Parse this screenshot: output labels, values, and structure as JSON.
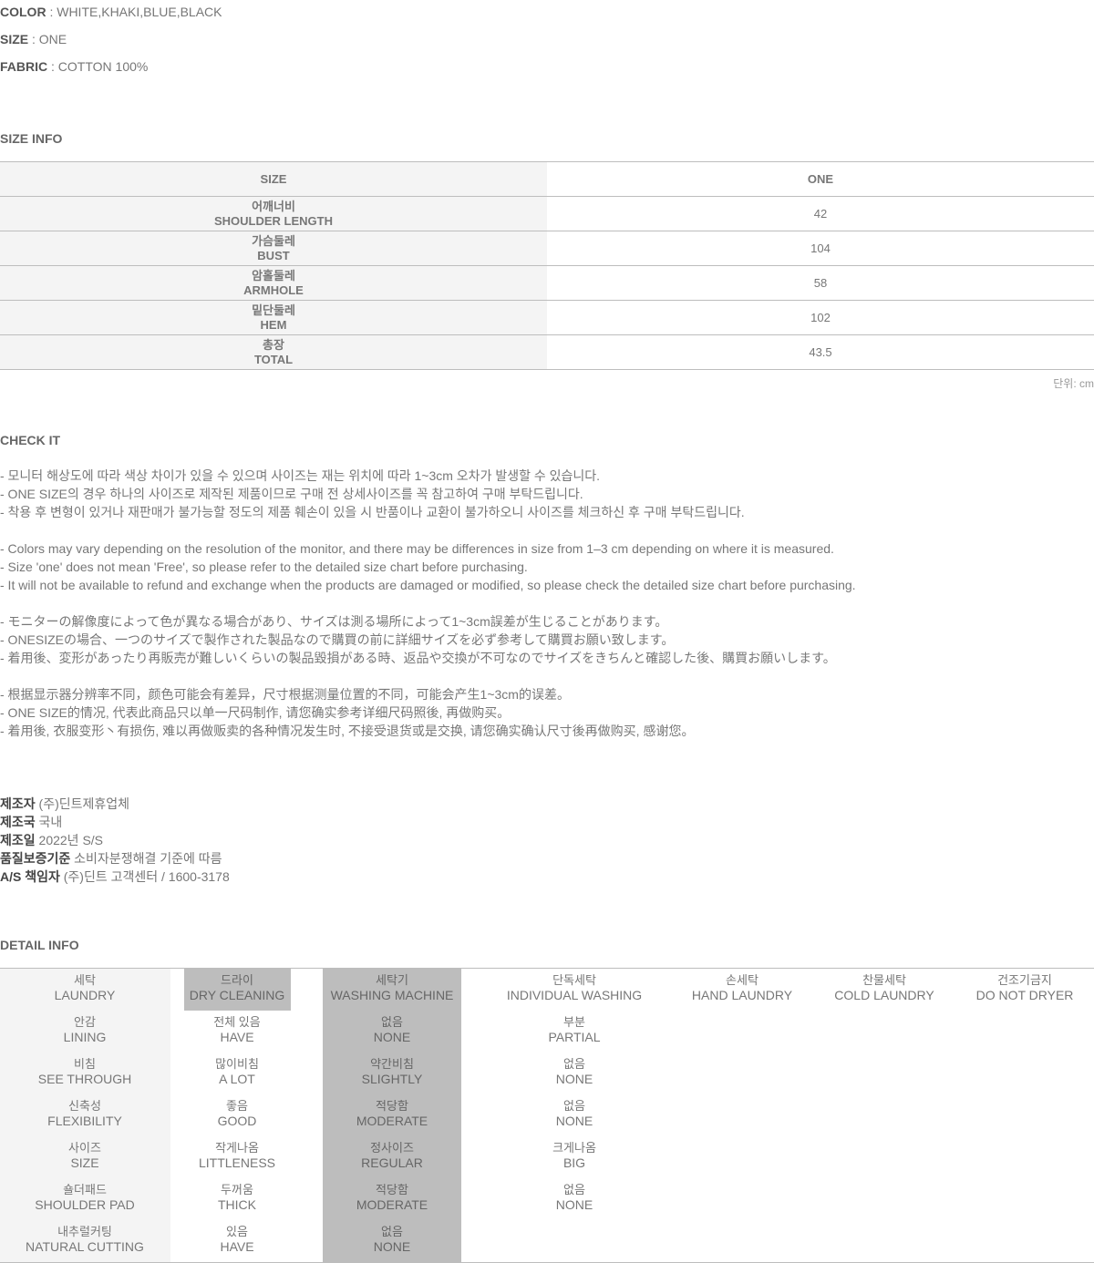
{
  "specs": [
    {
      "label": "COLOR",
      "value": " : WHITE,KHAKI,BLUE,BLACK"
    },
    {
      "label": "SIZE",
      "value": " : ONE"
    },
    {
      "label": "FABRIC",
      "value": " : COTTON 100%"
    }
  ],
  "size_info": {
    "title": "SIZE INFO",
    "header": {
      "label": "SIZE",
      "value": "ONE"
    },
    "rows": [
      {
        "ko": "어깨너비",
        "en": "SHOULDER LENGTH",
        "value": "42"
      },
      {
        "ko": "가슴둘레",
        "en": "BUST",
        "value": "104"
      },
      {
        "ko": "암홀둘레",
        "en": "ARMHOLE",
        "value": "58"
      },
      {
        "ko": "밑단둘레",
        "en": "HEM",
        "value": "102"
      },
      {
        "ko": "총장",
        "en": "TOTAL",
        "value": "43.5"
      }
    ],
    "unit": "단위: cm"
  },
  "check_it": {
    "title": "CHECK IT",
    "lines": [
      "- 모니터 해상도에 따라 색상 차이가 있을 수 있으며 사이즈는 재는 위치에 따라 1~3cm 오차가 발생할 수 있습니다.",
      "- ONE SIZE의 경우 하나의 사이즈로 제작된 제품이므로 구매 전 상세사이즈를 꼭 참고하여 구매 부탁드립니다.",
      "- 착용 후 변형이 있거나 재판매가 불가능할 정도의 제품 훼손이 있을 시 반품이나 교환이 불가하오니 사이즈를 체크하신 후 구매 부탁드립니다.",
      "",
      "- Colors may vary depending on the resolution of the monitor, and there may be differences in size from 1–3 cm depending on where it is measured.",
      "- Size 'one' does not mean 'Free', so please refer to the detailed size chart before purchasing.",
      "- It will not be available to refund and exchange when the products are damaged or modified, so please check the detailed size chart before purchasing.",
      "",
      "- モニターの解像度によって色が異なる場合があり、サイズは測る場所によって1~3cm誤差が生じることがあります。",
      "- ONESIZEの場合、一つのサイズで製作された製品なので購買の前に詳細サイズを必ず参考して購買お願い致します。",
      "- 着用後、変形があったり再販売が難しいくらいの製品毀損がある時、返品や交換が不可なのでサイズをきちんと確認した後、購買お願いします。",
      "",
      "- 根据显示器分辨率不同，颜色可能会有差异，尺寸根据测量位置的不同，可能会产生1~3cm的误差。",
      "- ONE SIZE的情况, 代表此商品只以单一尺码制作, 请您确实参考详细尺码照後, 再做购买。",
      "- 着用後, 衣服变形丶有损伤, 难以再做贩卖的各种情况发生时, 不接受退货或是交换, 请您确实确认尺寸後再做购买, 感谢您。"
    ]
  },
  "maker": [
    {
      "label": "제조자",
      "value": " (주)딘트제휴업체"
    },
    {
      "label": "제조국",
      "value": " 국내"
    },
    {
      "label": "제조일",
      "value": " 2022년 S/S"
    },
    {
      "label": "품질보증기준",
      "value": " 소비자분쟁해결 기준에 따름"
    },
    {
      "label": "A/S 책임자",
      "value": " (주)딘트 고객센터 / 1600-3178"
    }
  ],
  "detail_info": {
    "title": "DETAIL INFO",
    "rows": [
      [
        {
          "ko": "세탁",
          "en": "LAUNDRY"
        },
        {
          "ko": "드라이",
          "en": "DRY CLEANING"
        },
        {
          "ko": "세탁기",
          "en": "WASHING MACHINE"
        },
        {
          "ko": "단독세탁",
          "en": "INDIVIDUAL WASHING"
        },
        {
          "ko": "손세탁",
          "en": "HAND LAUNDRY"
        },
        {
          "ko": "찬물세탁",
          "en": "COLD LAUNDRY"
        },
        {
          "ko": "건조기금지",
          "en": "DO NOT DRYER"
        }
      ],
      [
        {
          "ko": "안감",
          "en": "LINING"
        },
        {
          "ko": "전체 있음",
          "en": "HAVE"
        },
        {
          "ko": "없음",
          "en": "NONE"
        },
        {
          "ko": "부분",
          "en": "PARTIAL"
        }
      ],
      [
        {
          "ko": "비침",
          "en": "SEE THROUGH"
        },
        {
          "ko": "많이비침",
          "en": "A LOT"
        },
        {
          "ko": "약간비침",
          "en": "SLIGHTLY"
        },
        {
          "ko": "없음",
          "en": "NONE"
        }
      ],
      [
        {
          "ko": "신축성",
          "en": "FLEXIBILITY"
        },
        {
          "ko": "좋음",
          "en": "GOOD"
        },
        {
          "ko": "적당함",
          "en": "MODERATE"
        },
        {
          "ko": "없음",
          "en": "NONE"
        }
      ],
      [
        {
          "ko": "사이즈",
          "en": "SIZE"
        },
        {
          "ko": "작게나옴",
          "en": "LITTLENESS"
        },
        {
          "ko": "정사이즈",
          "en": "REGULAR"
        },
        {
          "ko": "크게나옴",
          "en": "BIG"
        }
      ],
      [
        {
          "ko": "숄더패드",
          "en": "SHOULDER PAD"
        },
        {
          "ko": "두꺼움",
          "en": "THICK"
        },
        {
          "ko": "적당함",
          "en": "MODERATE"
        },
        {
          "ko": "없음",
          "en": "NONE"
        }
      ],
      [
        {
          "ko": "내추럴커팅",
          "en": "NATURAL CUTTING"
        },
        {
          "ko": "있음",
          "en": "HAVE"
        },
        {
          "ko": "없음",
          "en": "NONE"
        }
      ]
    ]
  }
}
